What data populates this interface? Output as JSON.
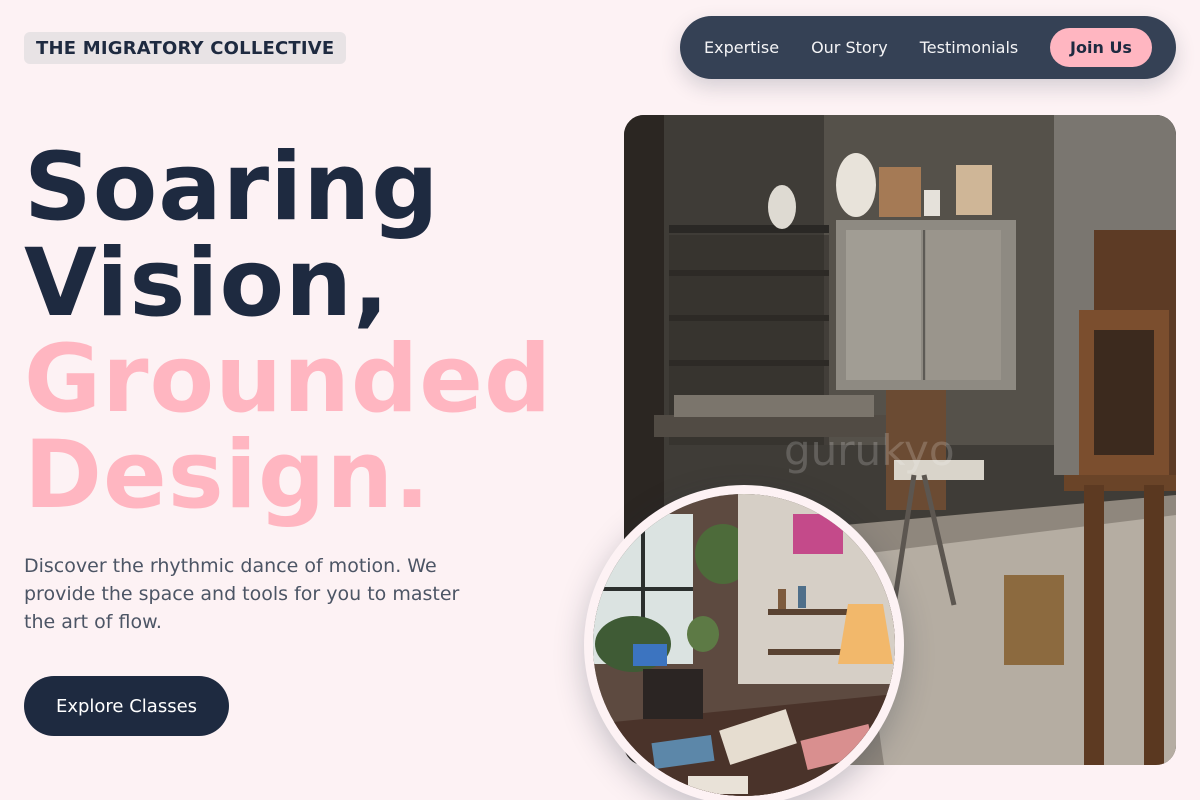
{
  "header": {
    "logo": "THE MIGRATORY COLLECTIVE"
  },
  "nav": {
    "links": [
      "Expertise",
      "Our Story",
      "Testimonials"
    ],
    "join_label": "Join Us"
  },
  "hero": {
    "line1": "Soaring",
    "line2": "Vision,",
    "line3": "Grounded",
    "line4": "Design.",
    "description": "Discover the rhythmic dance of motion. We provide the space and tools for you to master the art of flow.",
    "cta_label": "Explore Classes"
  },
  "images": {
    "main_icon": "studio-workshop-photo",
    "circle_icon": "art-studio-photo"
  },
  "colors": {
    "background": "#fdf2f4",
    "navy": "#1e2a40",
    "nav_bg": "#354155",
    "pink": "#ffb6c1",
    "text_muted": "#4c5565"
  }
}
